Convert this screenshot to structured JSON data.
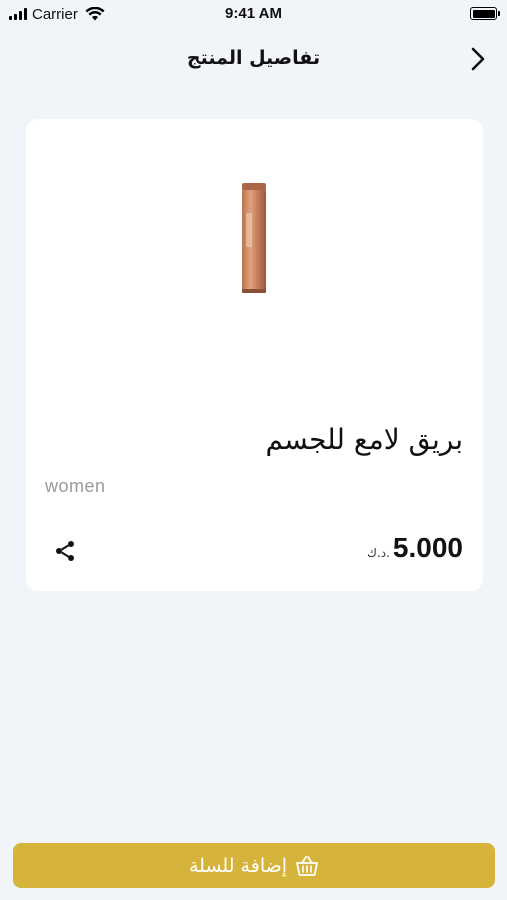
{
  "status_bar": {
    "carrier": "Carrier",
    "time": "9:41 AM"
  },
  "nav": {
    "title": "تفاصيل المنتج",
    "back_icon": "chevron-right-icon"
  },
  "product": {
    "name": "بريق لامع للجسم",
    "category": "women",
    "price": "5.000",
    "currency": "د.ك.",
    "share_icon": "share-icon"
  },
  "cart": {
    "add_label": "إضافة للسلة",
    "icon": "basket-icon"
  },
  "colors": {
    "accent": "#d6b43c",
    "background": "#f1f4f8",
    "card": "#ffffff"
  }
}
